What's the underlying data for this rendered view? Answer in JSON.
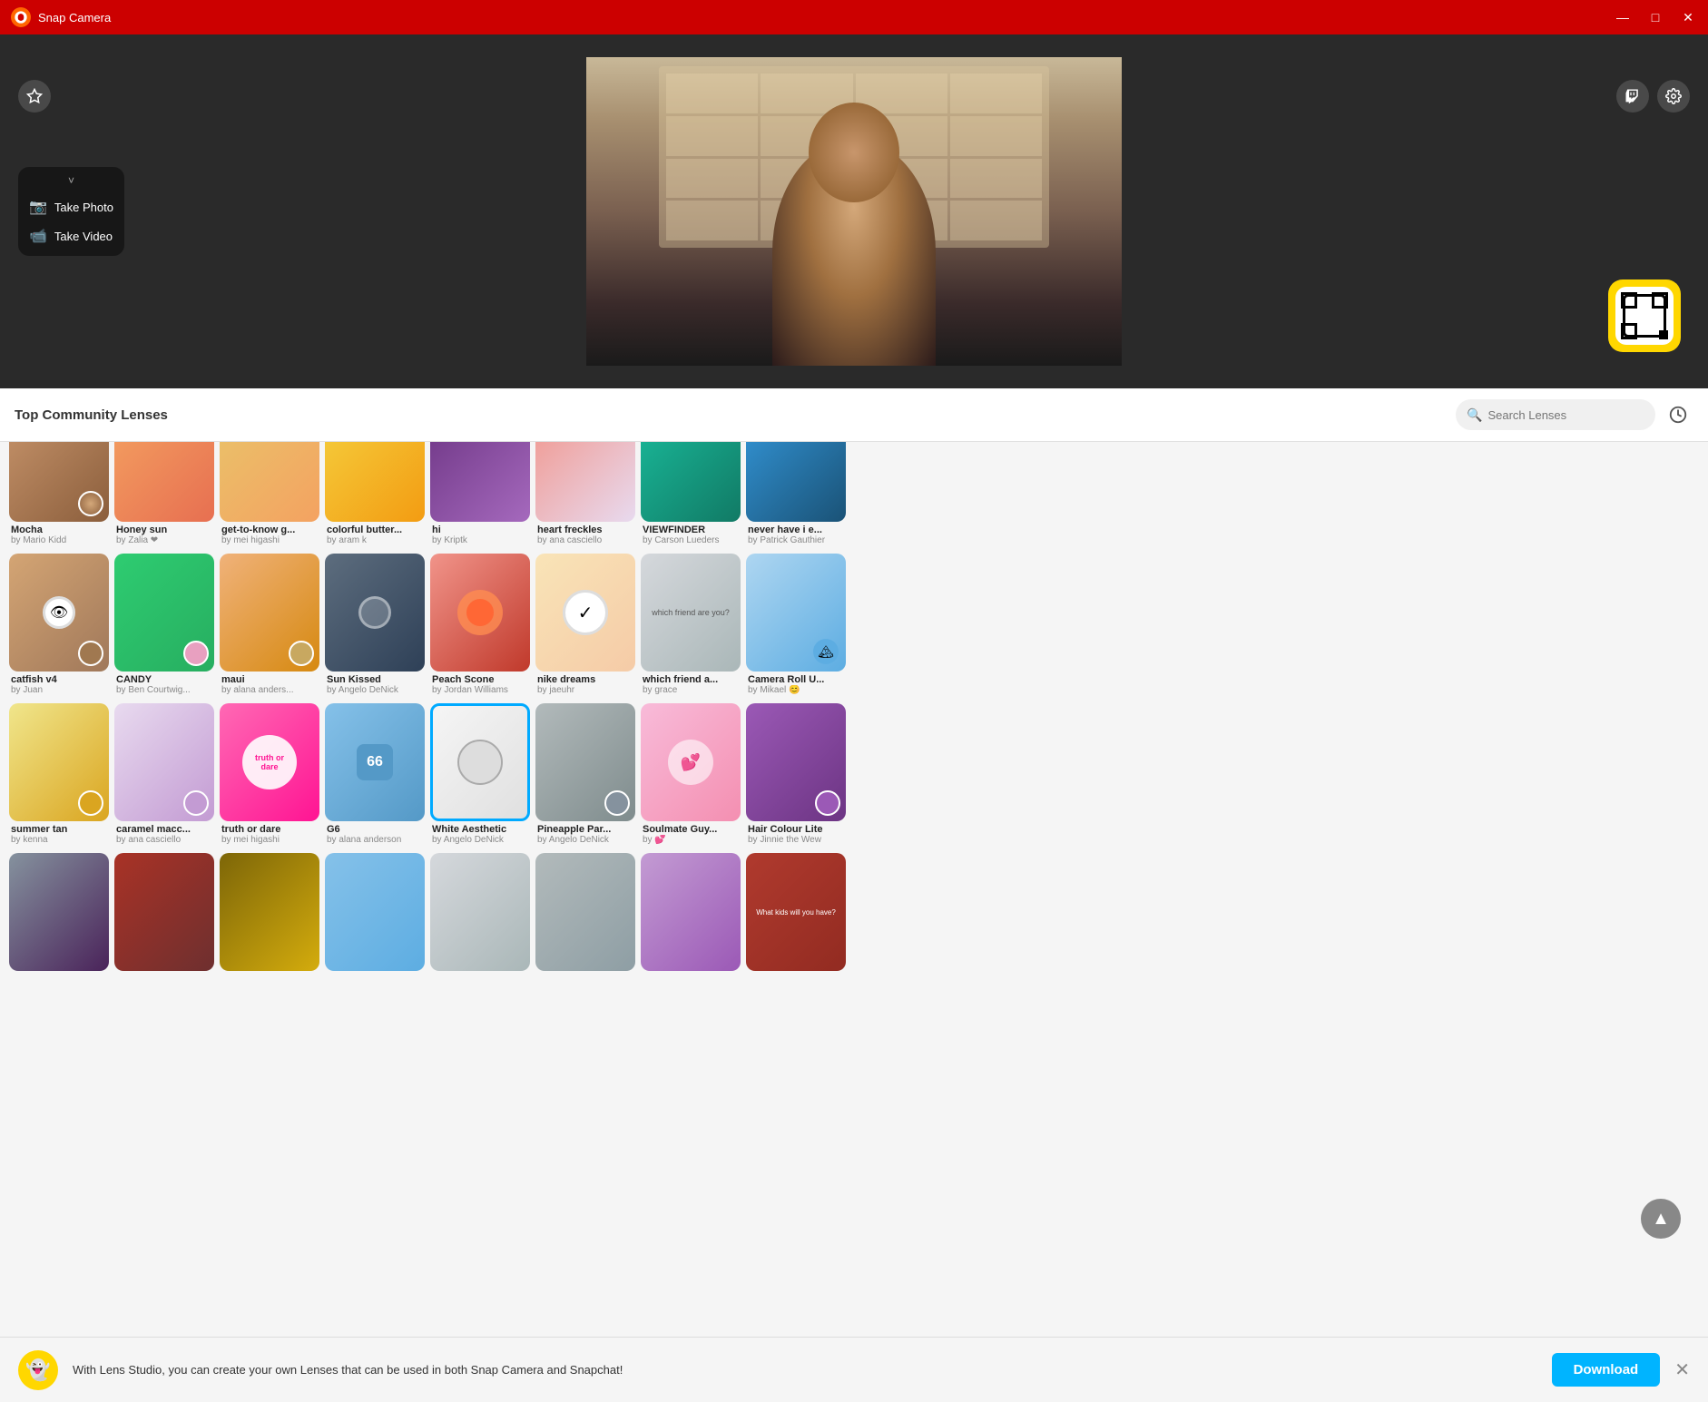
{
  "app": {
    "title": "Snap Camera",
    "logo": "👻"
  },
  "titlebar": {
    "title": "Snap Camera",
    "minimize": "—",
    "maximize": "□",
    "close": "✕"
  },
  "camera": {
    "controls": {
      "arrow": "˅",
      "take_photo": "Take Photo",
      "take_video": "Take Video"
    }
  },
  "search": {
    "section_title": "Top Community Lenses",
    "placeholder": "Search Lenses"
  },
  "lens_rows": {
    "row0": [
      {
        "name": "Mocha",
        "author": "by Mario Kidd",
        "thumb": "mocha",
        "avatar": true
      },
      {
        "name": "Honey sun",
        "author": "by Zalia ❤",
        "thumb": "honeysun"
      },
      {
        "name": "get-to-know g...",
        "author": "by mei higashi",
        "thumb": "gettoknow"
      },
      {
        "name": "colorful butter...",
        "author": "by aram k",
        "thumb": "colorful"
      },
      {
        "name": "hi",
        "author": "by Kriptk",
        "thumb": "hi"
      },
      {
        "name": "heart freckles",
        "author": "by ana casciello",
        "thumb": "heartfreckles"
      },
      {
        "name": "VIEWFINDER",
        "author": "by Carson Lueders",
        "thumb": "viewfinder"
      },
      {
        "name": "never have i e...",
        "author": "by Patrick Gauthier",
        "thumb": "neverhave"
      }
    ],
    "row1": [
      {
        "name": "catfish v4",
        "author": "by Juan",
        "thumb": "catfish"
      },
      {
        "name": "CANDY",
        "author": "by Ben Courtwig...",
        "thumb": "candy"
      },
      {
        "name": "maui",
        "author": "by alana anders...",
        "thumb": "maui"
      },
      {
        "name": "Sun Kissed",
        "author": "by Angelo DeNick",
        "thumb": "sunkissed"
      },
      {
        "name": "Peach Scone",
        "author": "by Jordan Williams",
        "thumb": "peachscone"
      },
      {
        "name": "nike dreams",
        "author": "by jaeuhr",
        "thumb": "nikedreams"
      },
      {
        "name": "which friend a...",
        "author": "by grace",
        "thumb": "whichfriend"
      },
      {
        "name": "Camera Roll U...",
        "author": "by Mikael 😊",
        "thumb": "cameraroll"
      }
    ],
    "row2": [
      {
        "name": "summer tan",
        "author": "by kenna",
        "thumb": "summertan"
      },
      {
        "name": "caramel macc...",
        "author": "by ana casciello",
        "thumb": "caramelmac"
      },
      {
        "name": "truth or dare",
        "author": "by mei higashi",
        "thumb": "truthordare"
      },
      {
        "name": "G6",
        "author": "by alana anderson",
        "thumb": "g6"
      },
      {
        "name": "White Aesthetic",
        "author": "by Angelo DeNick",
        "thumb": "whiteaesthetic",
        "selected": true
      },
      {
        "name": "Pineapple Par...",
        "author": "by Angelo DeNick",
        "thumb": "pineapple"
      },
      {
        "name": "Soulmate Guy...",
        "author": "by 💕",
        "thumb": "soulmate"
      },
      {
        "name": "Hair Colour Lite",
        "author": "by Jinnie the Wew",
        "thumb": "haircolour"
      }
    ],
    "row3": [
      {
        "name": "",
        "author": "",
        "thumb": "row4a"
      },
      {
        "name": "",
        "author": "",
        "thumb": "row4b"
      },
      {
        "name": "",
        "author": "",
        "thumb": "row4c"
      },
      {
        "name": "",
        "author": "",
        "thumb": "row4d"
      },
      {
        "name": "",
        "author": "",
        "thumb": "row4e"
      },
      {
        "name": "",
        "author": "",
        "thumb": "row4f"
      },
      {
        "name": "",
        "author": "",
        "thumb": "row4g"
      },
      {
        "name": "",
        "author": "",
        "thumb": "row4h"
      }
    ]
  },
  "notification": {
    "icon": "👻",
    "text": "With Lens Studio, you can create your own Lenses that can be used in both Snap Camera and Snapchat!",
    "download_label": "Download",
    "close": "✕"
  },
  "scroll_up": "▲"
}
